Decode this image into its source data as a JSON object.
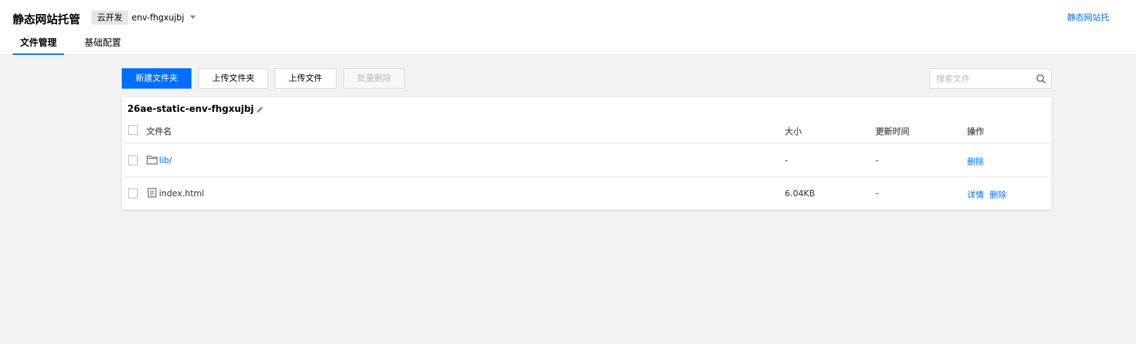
{
  "header": {
    "title": "静态网站托管",
    "env_tag": "云开发",
    "env_name": "env-fhgxujbj",
    "top_link": "静态网站托"
  },
  "tabs": [
    {
      "label": "文件管理",
      "active": true
    },
    {
      "label": "基础配置",
      "active": false
    }
  ],
  "toolbar": {
    "new_folder": "新建文件夹",
    "upload_folder": "上传文件夹",
    "upload_file": "上传文件",
    "batch_delete": "批量删除",
    "search_placeholder": "搜索文件"
  },
  "bucket": {
    "path": "26ae-static-env-fhgxujbj"
  },
  "table": {
    "columns": {
      "name": "文件名",
      "size": "大小",
      "updated": "更新时间",
      "actions": "操作"
    },
    "rows": [
      {
        "name": "lib/",
        "type": "folder",
        "size": "-",
        "updated": "-",
        "details": "",
        "delete": "删除"
      },
      {
        "name": "index.html",
        "type": "file",
        "size": "6.04KB",
        "updated": "-",
        "details": "详情",
        "delete": "删除"
      }
    ]
  },
  "colors": {
    "accent": "#006eff",
    "page_bg": "#f2f2f2"
  }
}
